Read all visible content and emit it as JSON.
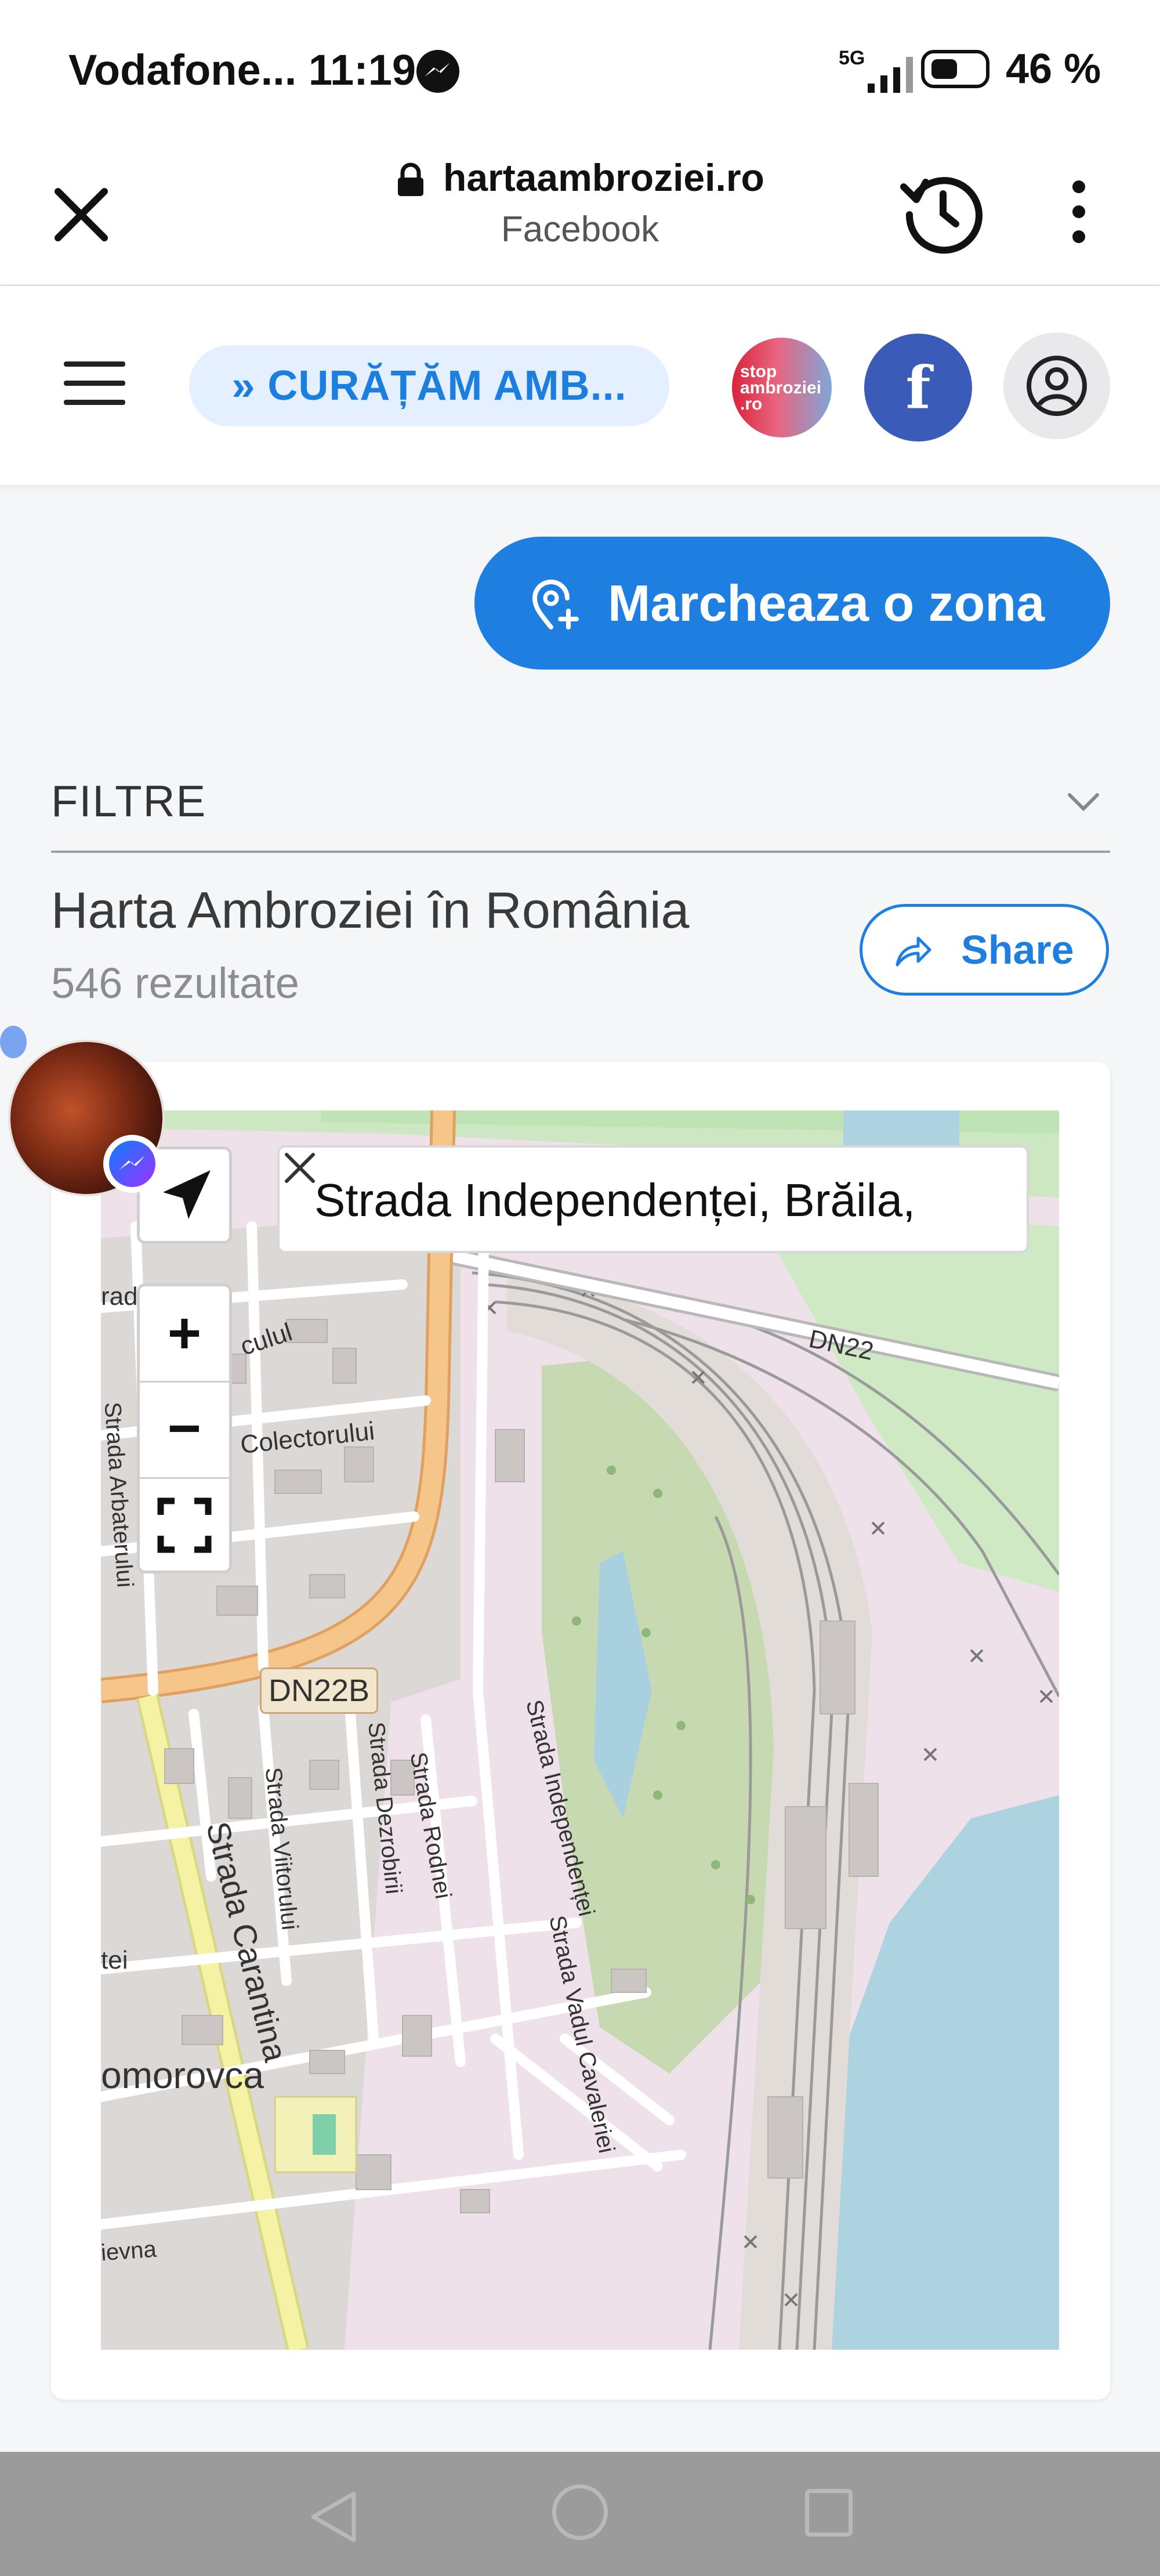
{
  "status_bar": {
    "carrier": "Vodafone...",
    "time": "11:19",
    "network": "5G",
    "battery_percent": "46 %"
  },
  "browser": {
    "domain": "hartaambroziei.ro",
    "subtitle": "Facebook",
    "close_icon": "close-icon",
    "history_icon": "history-icon",
    "more_icon": "more-vert-icon"
  },
  "site_header": {
    "menu_icon": "hamburger-icon",
    "banner_label": "» CURĂȚĂM AMB...",
    "stop_logo_lines": [
      "stop",
      "ambroziei",
      ".ro"
    ],
    "facebook_icon": "facebook-icon",
    "account_icon": "account-icon"
  },
  "actions": {
    "mark_zone_label": "Marcheaza o zona"
  },
  "filters": {
    "label": "FILTRE"
  },
  "results": {
    "title": "Harta Ambroziei în România",
    "count": "546 rezultate",
    "share_label": "Share"
  },
  "map": {
    "search_value": "Strada Independenței, Brăila,",
    "zoom_in": "+",
    "zoom_out": "−",
    "labels": {
      "dn22": "DN22",
      "dn22b": "DN22B",
      "colectorului": "Colectorului",
      "culul": "culul",
      "rad": "rad",
      "arbaterului": "Strada Arbaterului",
      "carantina": "Strada Carantina",
      "viitorului": "Strada Viitorului",
      "dezrobirii": "Strada Dezrobirii",
      "rodnei": "Strada Rodnei",
      "independentei": "Strada Independenței",
      "vadul": "Strada Vadul Cavaleriei",
      "tei": "tei",
      "comorovca": "omorovca",
      "nevna": "ievna"
    }
  },
  "colors": {
    "accent": "#1e7fe0",
    "facebook": "#3b5bb8",
    "pill_bg": "#e4efff",
    "nav_bar": "#9b9b9b"
  }
}
